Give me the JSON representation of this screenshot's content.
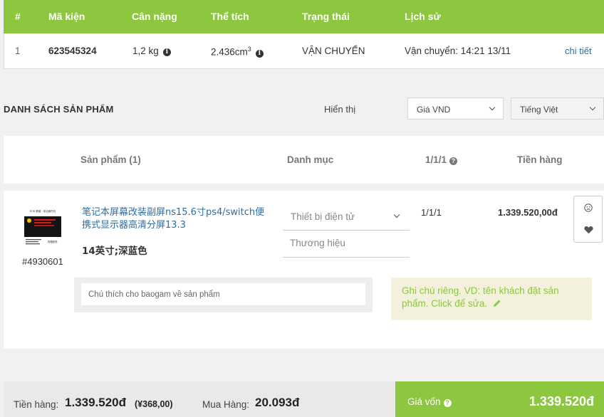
{
  "package_table": {
    "headers": [
      "#",
      "Mã kiện",
      "Cân nặng",
      "Thể tích",
      "Trạng thái",
      "Lịch sử"
    ],
    "row": {
      "index": "1",
      "code": "623545324",
      "weight": "1,2 kg",
      "volume": "2.436cm",
      "volume_exp": "3",
      "status": "VẬN CHUYỂN",
      "history": "Vận chuyển: 14:21 13/11",
      "detail_link": "chi tiết"
    }
  },
  "products_section": {
    "title": "DANH SÁCH SẢN PHẨM",
    "show_label": "Hiển thị",
    "currency_select": "Giá VND",
    "language_select": "Tiếng Việt"
  },
  "product_table": {
    "headers": {
      "product": "Sản phẩm (1)",
      "category": "Danh mục",
      "quantity": "1/1/1",
      "amount": "Tiền hàng"
    }
  },
  "product": {
    "image_text": "EOR 屏幕 · 综合套件包",
    "image_footer": "规格配件",
    "sku": "#4930601",
    "name": "笔记本屏幕改装副屏ns15.6寸ps4/switch便携式显示器高清分屏13.3",
    "variant": "14英寸;深蓝色",
    "category_placeholder": "Thiết bị điện tử",
    "brand_placeholder": "Thương hiệu",
    "quantity": "1/1/1",
    "amount": "1.339.520,00đ",
    "note_placeholder": "Chú thích cho baogam về sản phẩm",
    "private_note": "Ghi chú riêng. VD: tên khách đặt sản phẩm. Click để sửa."
  },
  "footer": {
    "subtotal_label": "Tiền hàng:",
    "subtotal_value": "1.339.520đ",
    "subtotal_cny": "(¥368,00)",
    "purchase_label": "Mua Hàng:",
    "purchase_value": "20.093đ",
    "cost_label": "Giá vốn",
    "cost_value": "1.339.520đ"
  },
  "colors": {
    "accent_green": "#8dc63f",
    "link_blue": "#2e6da4",
    "note_bg": "#f3f0dc"
  },
  "icons": [
    "info-icon",
    "question-icon",
    "chevron-down-icon",
    "pencil-icon",
    "sad-face-icon",
    "heart-icon"
  ]
}
